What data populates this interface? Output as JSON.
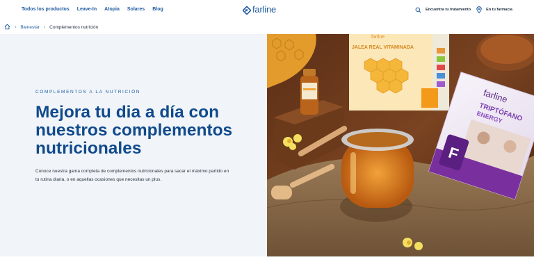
{
  "header": {
    "nav": [
      "Todos los productos",
      "Leave-In",
      "Atopia",
      "Solares",
      "Blog"
    ],
    "logo_text": "farline",
    "treatment_label": "Encuentra tu tratamiento",
    "pharmacy_label": "En tu farmacia",
    "icons": {
      "search": "search-icon",
      "location": "location-pin-icon"
    }
  },
  "breadcrumb": {
    "home_icon": "home-icon",
    "items": [
      "Bienestar",
      "Complementos nutrición"
    ]
  },
  "hero": {
    "eyebrow": "COMPLEMENTOS A LA NUTRICIÓN",
    "title": "Mejora tu dia a día con nuestros complementos nutricionales",
    "description": "Conoce nuestra gama completa de complementos nutricionales para sacar el máximo partido en tu rutina diaria, o en aquellas ocasiones que necesitas un plus.",
    "image": {
      "box1_brand": "farline",
      "box1_name": "JALEA REAL VITAMINADA",
      "box2_brand": "farline",
      "box2_name": "TRIPTÓFANO ENERGY"
    }
  },
  "colors": {
    "brand_blue": "#1e5aa0",
    "title_blue": "#114a8c",
    "hero_bg": "#f1f5f9"
  }
}
